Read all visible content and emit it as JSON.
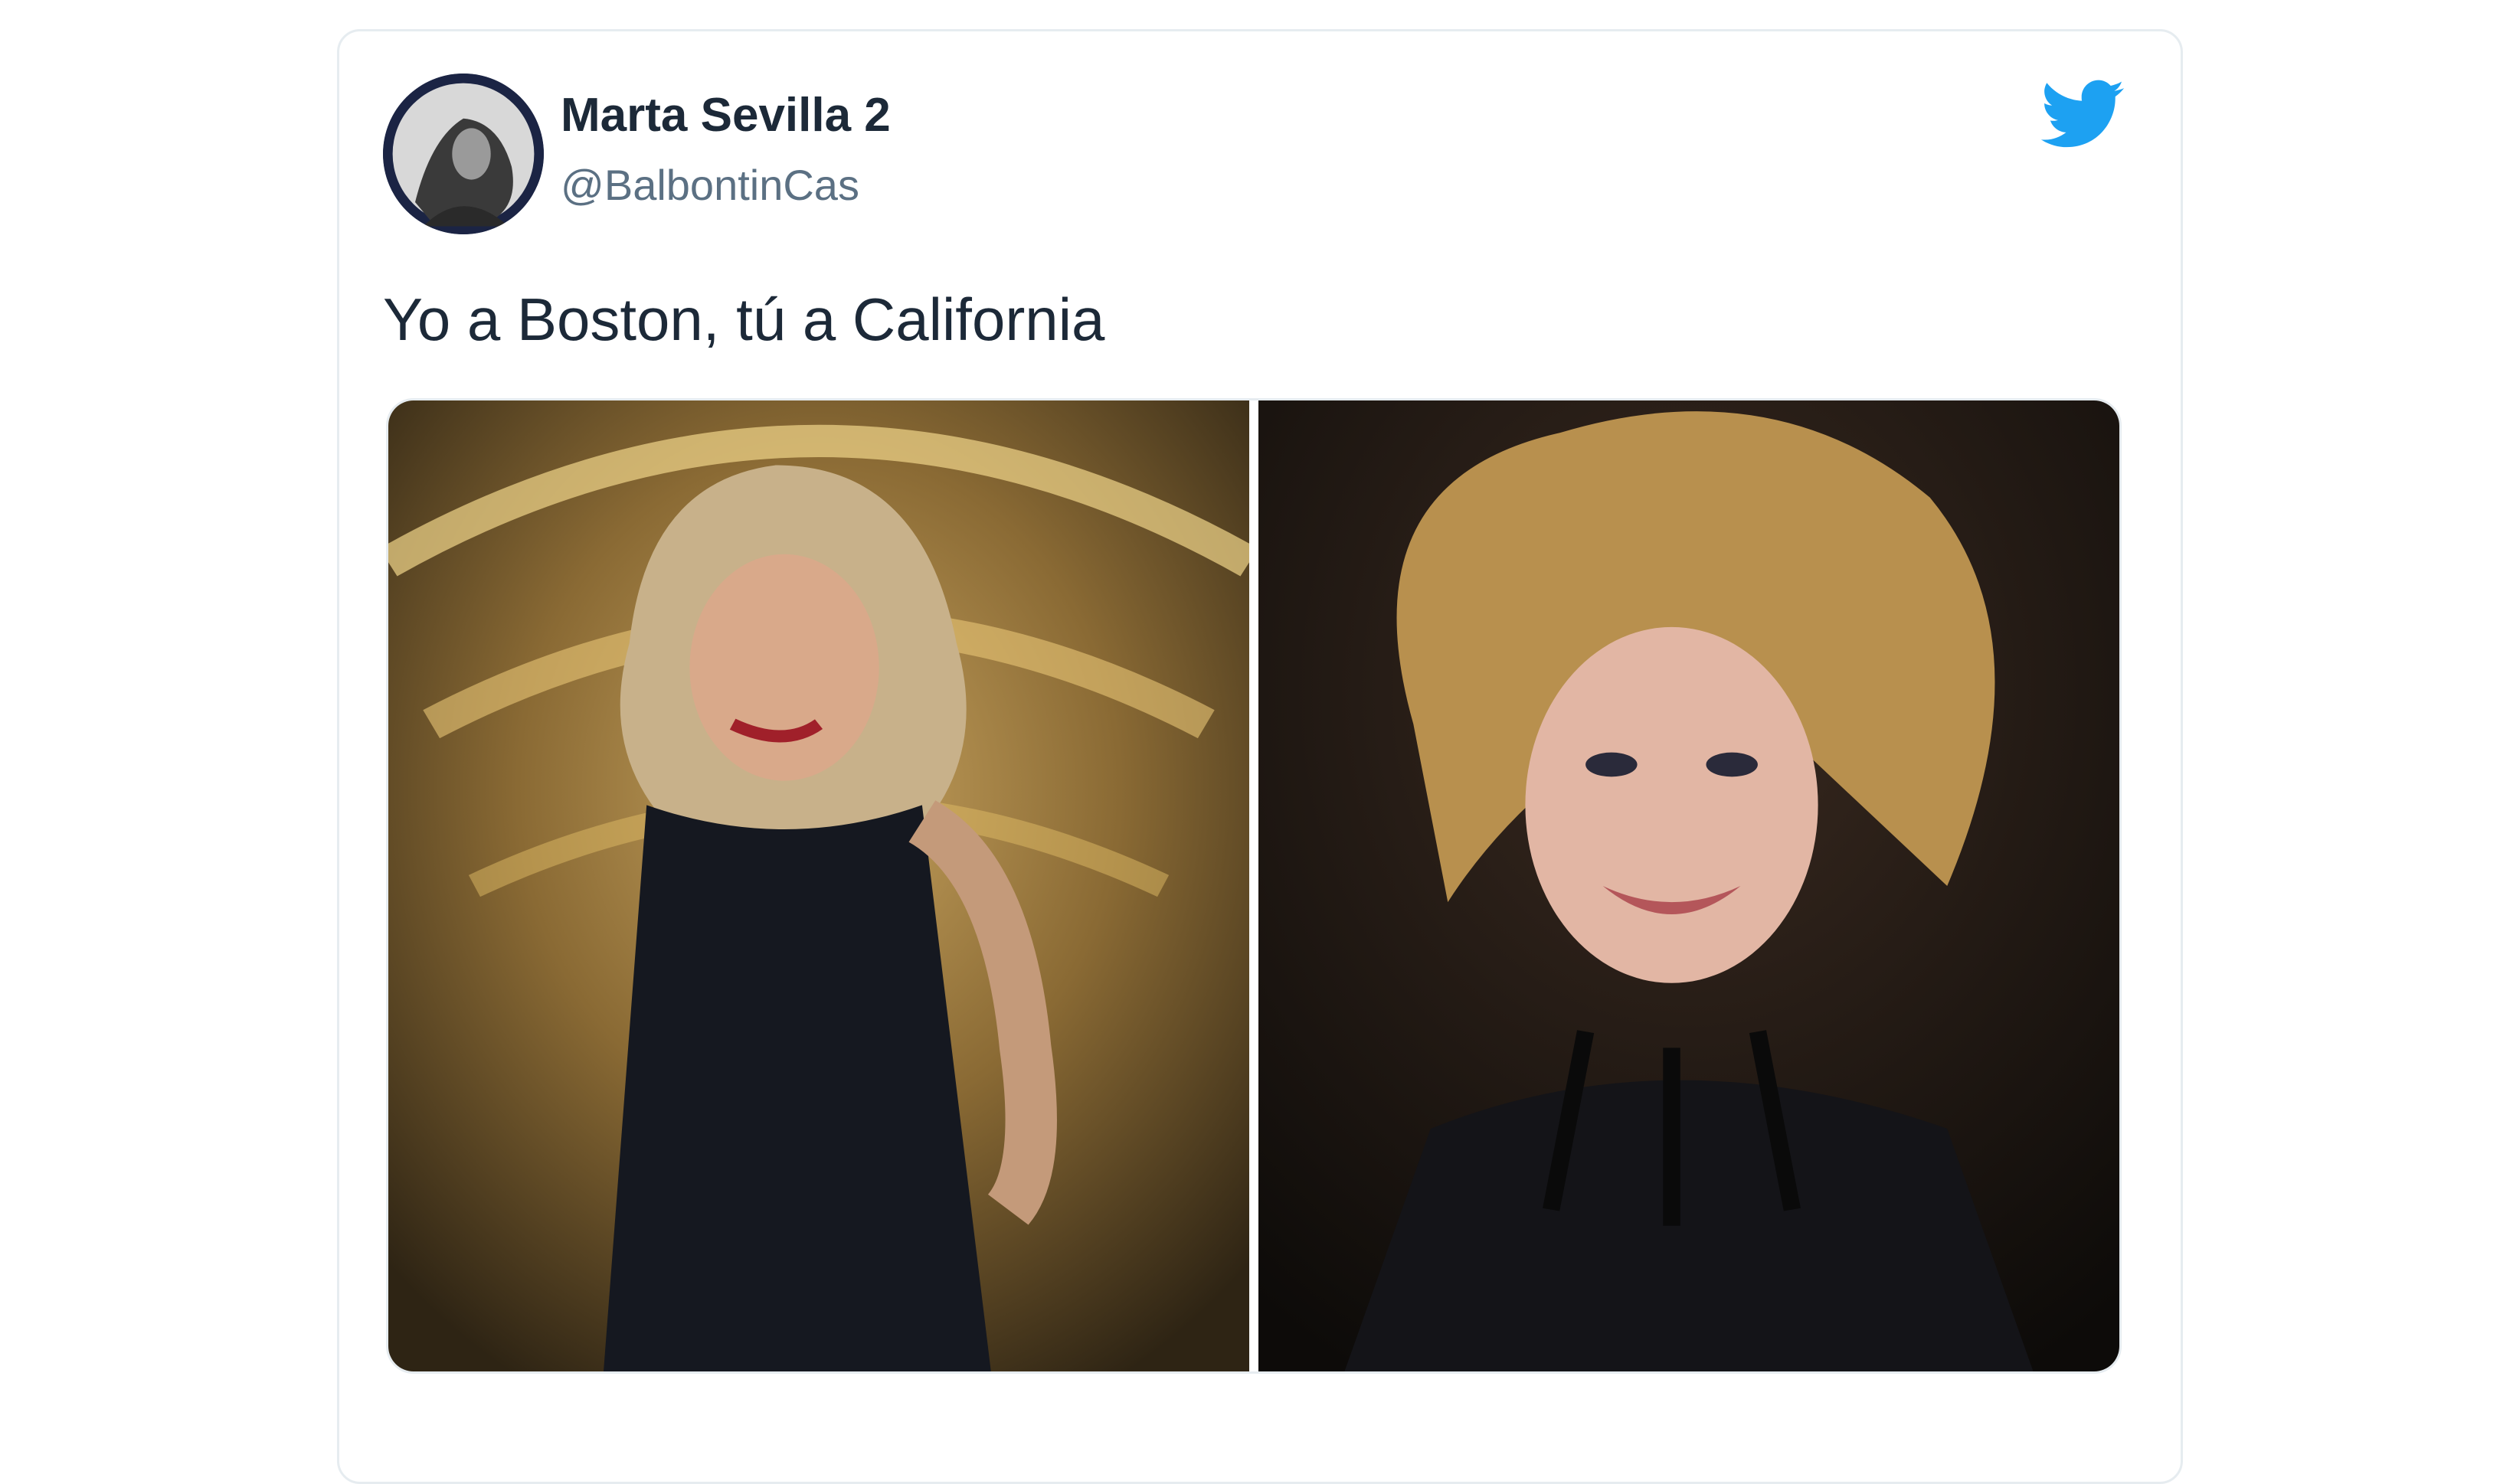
{
  "tweet": {
    "author": {
      "display_name": "Marta Sevilla 2",
      "handle": "@BalbontinCas",
      "avatar_icon": "profile-photo"
    },
    "text": "Yo a Boston, tú a California",
    "brand_icon": "twitter-bird-icon",
    "brand_color": "#1da1f2",
    "media": [
      {
        "kind": "photo",
        "description_icon": "portrait-photo-left"
      },
      {
        "kind": "photo",
        "description_icon": "portrait-photo-right"
      }
    ]
  }
}
